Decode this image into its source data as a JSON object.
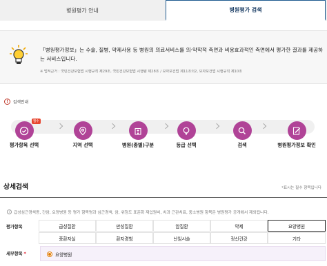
{
  "tabs": [
    {
      "label": "병원평가 안내"
    },
    {
      "label": "병원평가 검색"
    }
  ],
  "intro": {
    "text": "「병원평가정보」는 수술, 질병, 약제사용 등 병원의 의료서비스를 의·약학적 측면과 비용효과적인 측면에서 평가한 결과를 제공하는 서비스입니다.",
    "legal": "※ 법적근거 : 국민건강보험법 시행규칙 제29조, 국민건강보험법 시행령 제28조 / 모자보건법 제11조의2, 모자보건법 시행규칙 제10조"
  },
  "guide": {
    "title": "검색안내",
    "steps": [
      {
        "label": "평가항목 선택",
        "badge": "필수",
        "icon": "check-circle-icon"
      },
      {
        "label": "지역 선택",
        "icon": "location-pin-icon"
      },
      {
        "label": "병원(종별)구분",
        "icon": "hospital-building-icon"
      },
      {
        "label": "등급 선택",
        "icon": "lightbulb-icon"
      },
      {
        "label": "검색",
        "icon": "search-icon"
      },
      {
        "label": "병원평가정보 확인",
        "icon": "document-edit-icon"
      }
    ]
  },
  "detail": {
    "title": "상세검색",
    "required_note": "*표시는 필수 항목입니다",
    "notice": "급성심근경색증, 간암, 요양병원 등 평가 항목명과 심근경색, 암, 위험도 표준화 재입원비, 치과 근관치료, 중소병원 항목은 병원평가 공개에서 제외됩니다.",
    "eval_label": "평가항목",
    "sub_label": "세부항목",
    "required_mark": "*",
    "items_row1": [
      "급성질환",
      "만성질환",
      "암질환",
      "약제",
      "요양병원"
    ],
    "items_row2": [
      "중환자실",
      "환자경험",
      "난임시술",
      "정신건강",
      "기타"
    ],
    "selected_item": "요양병원",
    "sub_option": "요양병원"
  },
  "colors": {
    "accent_purple": "#b04397",
    "tab_border": "#1d5a8f",
    "badge_red": "#e7452f",
    "radio_orange": "#e07a00"
  }
}
